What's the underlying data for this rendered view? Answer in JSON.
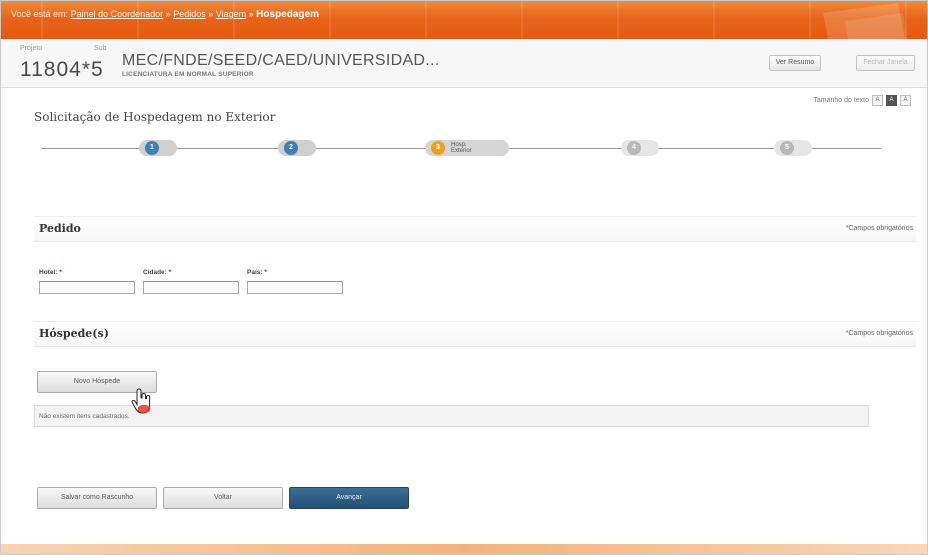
{
  "breadcrumb": {
    "prefix": "Você está em:",
    "items": [
      "Painel do Coordenador",
      "Pedidos",
      "Viagem"
    ],
    "separator": "»",
    "current": "Hospedagem"
  },
  "project": {
    "number_label": "Projeto",
    "number": "11804*5",
    "sub_label": "Sub",
    "title": "MEC/FNDE/SEED/CAED/UNIVERSIDAD...",
    "subtitle": "LICENCIATURA EM NORMAL SUPERIOR",
    "btn_view_summary": "Ver Resumo",
    "btn_close": "Fechar Janela"
  },
  "text_size": {
    "label": "Tamanho do texto",
    "options": [
      "A",
      "A",
      "A"
    ]
  },
  "page": {
    "title": "Solicitação de Hospedagem no Exterior"
  },
  "stepper": {
    "steps": [
      {
        "num": "1",
        "state": "done"
      },
      {
        "num": "2",
        "state": "done"
      },
      {
        "num": "3",
        "state": "active",
        "label_line1": "Hosp.",
        "label_line2": "Exterior"
      },
      {
        "num": "4",
        "state": "todo"
      },
      {
        "num": "5",
        "state": "todo"
      }
    ]
  },
  "pedido": {
    "title": "Pedido",
    "required_note": "*Campos obrigatórios",
    "fields": [
      {
        "label": "Hotel:",
        "required": "*",
        "value": ""
      },
      {
        "label": "Cidade:",
        "required": "*",
        "value": ""
      },
      {
        "label": "País:",
        "required": "*",
        "value": ""
      }
    ]
  },
  "hospedes": {
    "title": "Hóspede(s)",
    "required_note": "*Campos obrigatórios",
    "new_button": "Novo Hóspede",
    "empty_message": "Não existem itens cadastrados."
  },
  "footer_buttons": {
    "save_draft": "Salvar como Rascunho",
    "back": "Voltar",
    "next": "Avançar"
  },
  "colors": {
    "topbar": "#e8641a",
    "step_done": "#3f7fb8",
    "step_active": "#f0a11c",
    "primary_button": "#2f5f85",
    "required_star": "#cc0000"
  }
}
